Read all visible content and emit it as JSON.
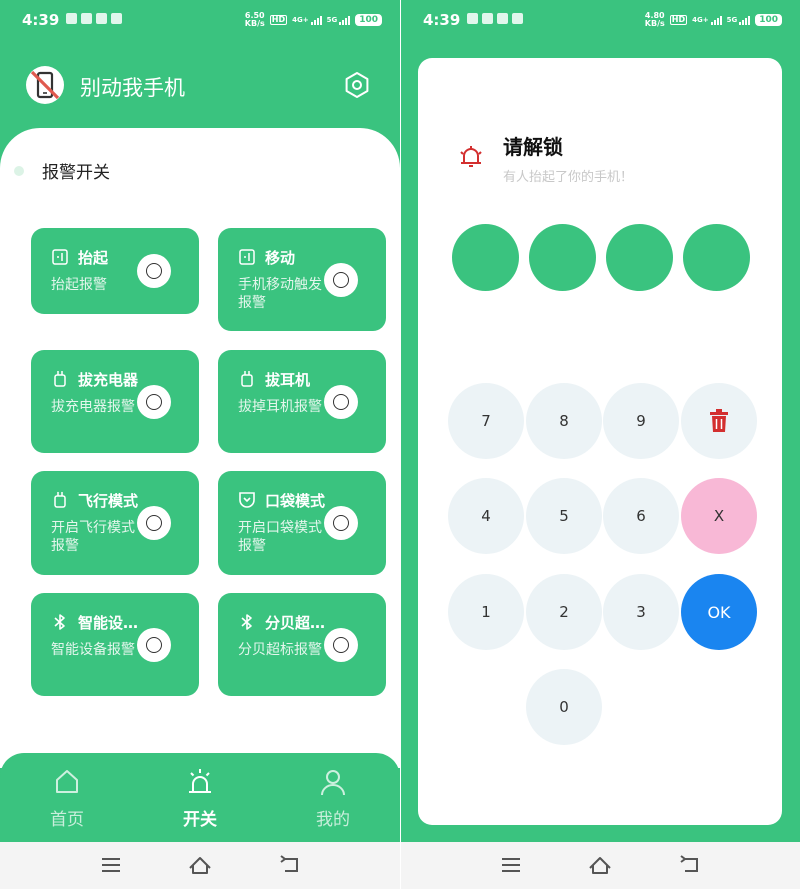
{
  "status_bar_left": {
    "time": "4:39",
    "net_speed": "6.50",
    "net_unit": "KB/s",
    "hd": "HD",
    "sig1": "4G+",
    "sig2": "5G",
    "battery": "100"
  },
  "status_bar_right": {
    "time": "4:39",
    "net_speed": "4.80",
    "net_unit": "KB/s",
    "hd": "HD",
    "sig1": "4G+",
    "sig2": "5G",
    "battery": "100"
  },
  "app": {
    "title": "别动我手机",
    "settings_icon": "gear-icon",
    "logo_icon": "phone-crossed-icon"
  },
  "alarm_switch": {
    "label": "报警开关"
  },
  "cards": [
    {
      "icon": "phone-lift-icon",
      "title": "抬起",
      "desc": "抬起报警",
      "enabled": false
    },
    {
      "icon": "phone-move-icon",
      "title": "移动",
      "desc": "手机移动触发报警",
      "enabled": false
    },
    {
      "icon": "charger-icon",
      "title": "拔充电器",
      "desc": "拔充电器报警",
      "enabled": false
    },
    {
      "icon": "charger-icon",
      "title": "拔耳机",
      "desc": "拔掉耳机报警",
      "enabled": false
    },
    {
      "icon": "charger-icon",
      "title": "飞行模式",
      "desc": "开启飞行模式报警",
      "enabled": false
    },
    {
      "icon": "pocket-icon",
      "title": "口袋模式",
      "desc": "开启口袋模式报警",
      "enabled": false
    },
    {
      "icon": "bluetooth-icon",
      "title": "智能设…",
      "desc": "智能设备报警",
      "enabled": false
    },
    {
      "icon": "bluetooth-icon",
      "title": "分贝超…",
      "desc": "分贝超标报警",
      "enabled": false
    }
  ],
  "nav": {
    "items": [
      {
        "label": "首页",
        "icon": "home-icon",
        "active": false
      },
      {
        "label": "开关",
        "icon": "alarm-icon",
        "active": true
      },
      {
        "label": "我的",
        "icon": "user-icon",
        "active": false
      }
    ]
  },
  "unlock": {
    "title": "请解锁",
    "subtitle": "有人抬起了你的手机！",
    "bell_icon": "bell-icon",
    "pin_count": 4,
    "keys": {
      "k7": "7",
      "k8": "8",
      "k9": "9",
      "delete_icon": "trash-icon",
      "k4": "4",
      "k5": "5",
      "k6": "6",
      "clear": "X",
      "k1": "1",
      "k2": "2",
      "k3": "3",
      "ok": "OK",
      "k0": "0"
    }
  },
  "colors": {
    "primary": "#3ac37f",
    "key_bg": "#ecf3f6",
    "clear_bg": "#f8b8d6",
    "ok_bg": "#1a85f0",
    "danger": "#d32f2f"
  }
}
